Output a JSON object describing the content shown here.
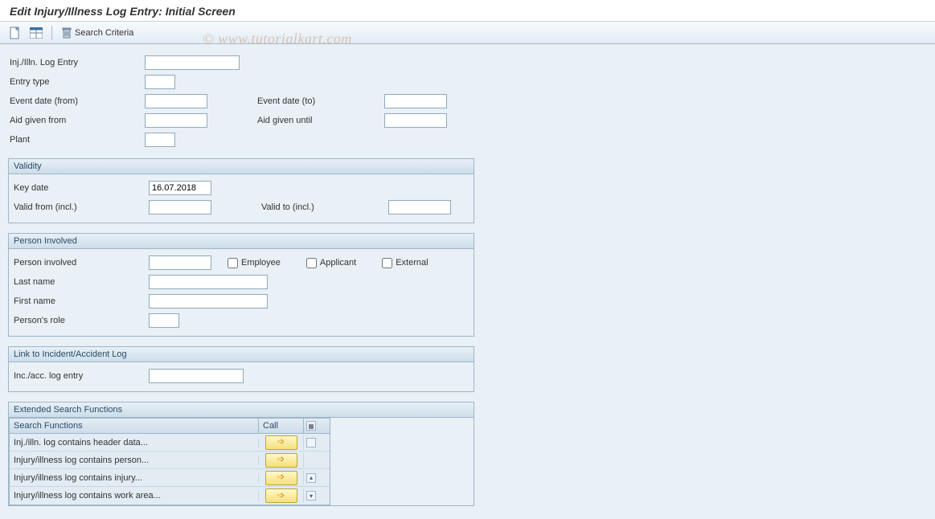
{
  "title": "Edit Injury/Illness Log Entry: Initial Screen",
  "watermark": "© www.tutorialkart.com",
  "toolbar": {
    "search_criteria_label": "Search Criteria"
  },
  "form": {
    "log_entry_label": "Inj./Illn. Log Entry",
    "log_entry_value": "",
    "entry_type_label": "Entry type",
    "entry_type_value": "",
    "event_date_from_label": "Event date (from)",
    "event_date_from_value": "",
    "event_date_to_label": "Event date (to)",
    "event_date_to_value": "",
    "aid_from_label": "Aid given from",
    "aid_from_value": "",
    "aid_until_label": "Aid given until",
    "aid_until_value": "",
    "plant_label": "Plant",
    "plant_value": ""
  },
  "validity": {
    "panel_label": "Validity",
    "key_date_label": "Key date",
    "key_date_value": "16.07.2018",
    "valid_from_label": "Valid from (incl.)",
    "valid_from_value": "",
    "valid_to_label": "Valid to (incl.)",
    "valid_to_value": ""
  },
  "person": {
    "panel_label": "Person Involved",
    "involved_label": "Person involved",
    "involved_value": "",
    "employee_label": "Employee",
    "applicant_label": "Applicant",
    "external_label": "External",
    "lastname_label": "Last name",
    "lastname_value": "",
    "firstname_label": "First name",
    "firstname_value": "",
    "role_label": "Person's role",
    "role_value": ""
  },
  "link": {
    "panel_label": "Link to Incident/Accident Log",
    "entry_label": "Inc./acc. log entry",
    "entry_value": ""
  },
  "ext_search": {
    "panel_label": "Extended Search Functions",
    "col_func": "Search Functions",
    "col_call": "Call",
    "rows": [
      {
        "label": "Inj./illn. log contains header data..."
      },
      {
        "label": "Injury/illness log contains person..."
      },
      {
        "label": "Injury/illness log contains injury..."
      },
      {
        "label": "Injury/illness log contains work area..."
      }
    ]
  }
}
